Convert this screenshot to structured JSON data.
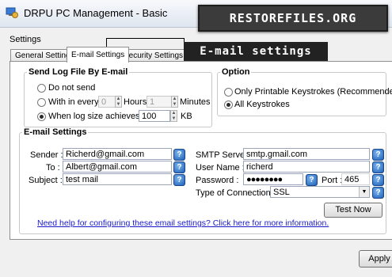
{
  "window": {
    "title": "DRPU PC Management - Basic"
  },
  "watermark": {
    "text": "RESTOREFILES.ORG"
  },
  "callout": {
    "text": "E-mail settings"
  },
  "settings_label": "Settings",
  "tabs": [
    {
      "label": "General Settings",
      "active": false
    },
    {
      "label": "E-mail Settings",
      "active": true
    },
    {
      "label": "Security Settings",
      "active": false
    }
  ],
  "send_log": {
    "legend": "Send Log File By E-mail",
    "do_not_send": "Do not send",
    "within_every": "With in every",
    "hours_value": "0",
    "hours_label": "Hours",
    "minutes_value": "1",
    "minutes_label": "Minutes",
    "when_log_size": "When log size achieves",
    "size_value": "100",
    "size_unit": "KB"
  },
  "option": {
    "legend": "Option",
    "printable": "Only Printable Keystrokes (Recommended)",
    "all": "All Keystrokes"
  },
  "email": {
    "legend": "E-mail Settings",
    "sender_label": "Sender :",
    "sender_value": "Richerd@gmail.com",
    "to_label": "To :",
    "to_value": "Albert@gmail.com",
    "subject_label": "Subject :",
    "subject_value": "test mail",
    "smtp_label": "SMTP Server :",
    "smtp_value": "smtp.gmail.com",
    "user_label": "User Name :",
    "user_value": "richerd",
    "password_label": "Password :",
    "password_value": "●●●●●●●●",
    "port_label": "Port :",
    "port_value": "465",
    "connection_label": "Type of Connection :",
    "connection_value": "SSL",
    "test_button": "Test Now",
    "help_link": "Need help for configuring these email settings? Click here for more information."
  },
  "apply_button": "Apply",
  "help_glyph": "?"
}
